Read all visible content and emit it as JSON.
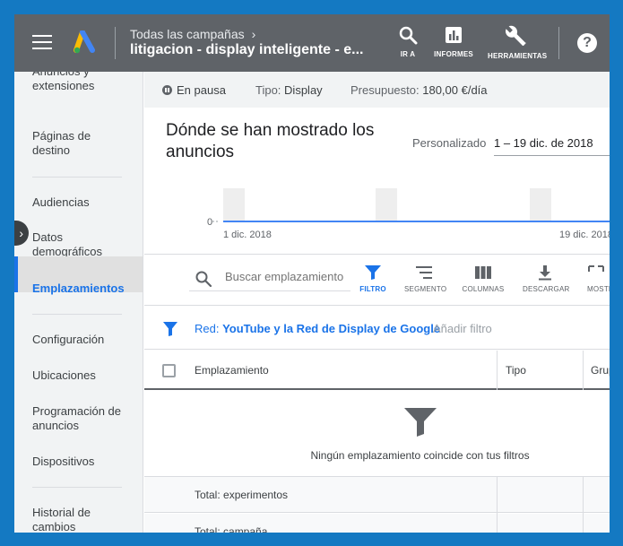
{
  "topbar": {
    "breadcrumb": "Todas las campañas",
    "campaign": "litigacion - display inteligente - e...",
    "tools": [
      "IR A",
      "INFORMES",
      "HERRAMIENTAS"
    ],
    "help": "?"
  },
  "sidebar": {
    "items": [
      "Anuncios y extensiones",
      "Páginas de destino",
      "Audiencias",
      "Datos demográficos",
      "Emplazamientos",
      "Configuración",
      "Ubicaciones",
      "Programación de anuncios",
      "Dispositivos",
      "Historial de cambios"
    ],
    "active": "Emplazamientos"
  },
  "status": {
    "state": "En pausa",
    "type_label": "Tipo:",
    "type_value": "Display",
    "budget_label": "Presupuesto:",
    "budget_value": "180,00 €/día"
  },
  "chart_data": {
    "type": "line",
    "title": "Dónde se han mostrado los anuncios",
    "x": [
      "1 dic. 2018",
      "19 dic. 2018"
    ],
    "series": [
      {
        "values": [
          0,
          0
        ]
      }
    ],
    "ytick_labels": [
      "0"
    ],
    "xtick_labels": [
      "1 dic. 2018",
      "19 dic. 2018"
    ]
  },
  "daterange": {
    "label": "Personalizado",
    "value": "1 – 19 dic. de 2018"
  },
  "toolbar": {
    "search_placeholder": "Buscar emplazamiento",
    "buttons": [
      "FILTRO",
      "SEGMENTO",
      "COLUMNAS",
      "DESCARGAR",
      "MOSTRAR"
    ]
  },
  "filter": {
    "prefix": "Red:",
    "value": "YouTube y la Red de Display de Google",
    "add": "Añadir filtro"
  },
  "table": {
    "columns": [
      "Emplazamiento",
      "Tipo",
      "Grupo de anuncios"
    ],
    "empty_message": "Ningún emplazamiento coincide con tus filtros",
    "totals": [
      "Total: experimentos",
      "Total: campaña"
    ]
  },
  "colors": {
    "topbar": "#5f6368",
    "accent": "#1a73e8",
    "frame": "#1479c2"
  }
}
